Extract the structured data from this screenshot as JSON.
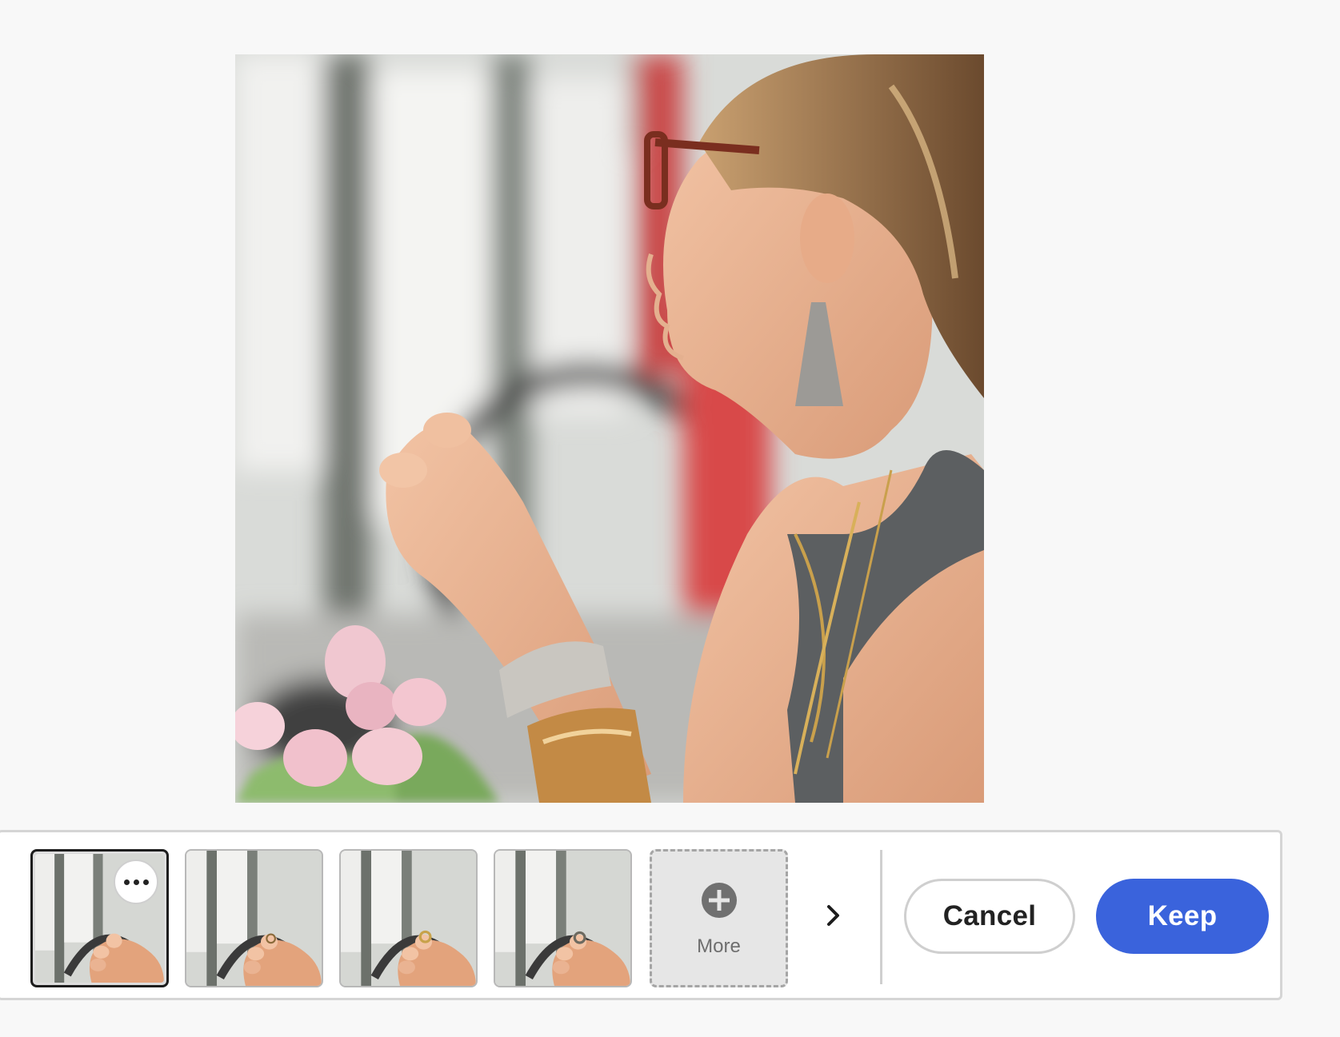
{
  "preview": {
    "alt_icon": "portrait-photo"
  },
  "variations": {
    "thumbnails": [
      {
        "selected": true
      },
      {
        "selected": false
      },
      {
        "selected": false
      },
      {
        "selected": false
      }
    ],
    "more_menu_icon": "ellipsis-icon",
    "more_tile": {
      "icon": "plus-circle-icon",
      "label": "More"
    },
    "next_icon": "chevron-right-icon"
  },
  "actions": {
    "cancel_label": "Cancel",
    "keep_label": "Keep"
  },
  "colors": {
    "background": "#f8f8f8",
    "keep_button": "#3a63dc",
    "selected_border": "#1d1d1d"
  }
}
